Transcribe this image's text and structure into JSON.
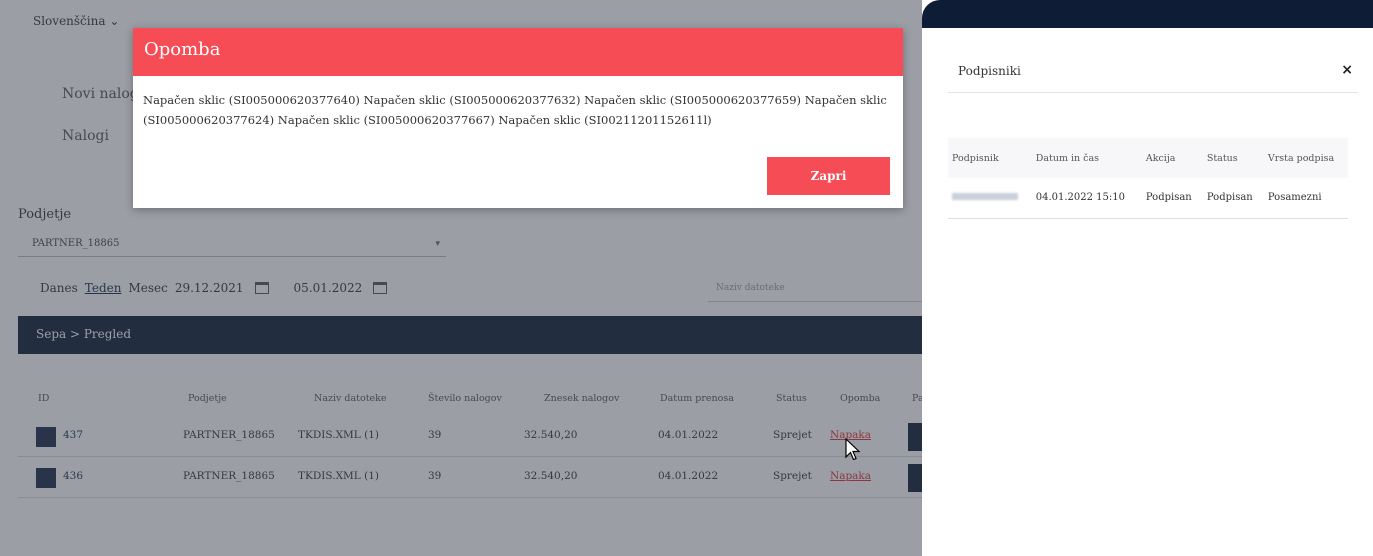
{
  "page": {
    "language": "Slovenščina",
    "nav": [
      "Novi nalog",
      "Nalogi"
    ],
    "subject_label": "Podjetje",
    "subject_value": "PARTNER_18865",
    "range": {
      "today": "Danes",
      "week": "Teden",
      "month": "Mesec",
      "from": "29.12.2021",
      "to": "05.01.2022"
    },
    "filename_placeholder": "Naziv datoteke",
    "breadcrumb": "Sepa > Pregled",
    "columns": [
      "ID",
      "Podjetje",
      "Naziv datoteke",
      "Število nalogov",
      "Znesek nalogov",
      "Datum prenosa",
      "Status",
      "Opomba",
      "Pa"
    ],
    "rows": [
      {
        "id": "437",
        "company": "PARTNER_18865",
        "file": "TKDIS.XML (1)",
        "count": "39",
        "amount": "32.540,20",
        "date": "04.01.2022",
        "status": "Sprejet",
        "note": "Napaka"
      },
      {
        "id": "436",
        "company": "PARTNER_18865",
        "file": "TKDIS.XML (1)",
        "count": "39",
        "amount": "32.540,20",
        "date": "04.01.2022",
        "status": "Sprejet",
        "note": "Napaka"
      }
    ]
  },
  "modal": {
    "title": "Opomba",
    "message": "Napačen sklic (SI005000620377640) Napačen sklic (SI005000620377632) Napačen sklic (SI005000620377659) Napačen sklic (SI005000620377624) Napačen sklic (SI005000620377667) Napačen sklic (SI00211201152611l)",
    "close_label": "Zapri"
  },
  "panel": {
    "title": "Podpisniki",
    "close_glyph": "×",
    "columns": [
      "Podpisnik",
      "Datum in čas",
      "Akcija",
      "Status",
      "Vrsta podpisa"
    ],
    "rows": [
      {
        "datetime": "04.01.2022 15:10",
        "action": "Podpisan",
        "status": "Podpisan",
        "type": "Posamezni"
      }
    ]
  },
  "colors": {
    "accent_red": "#f64c56",
    "navy": "#0e1d35"
  }
}
